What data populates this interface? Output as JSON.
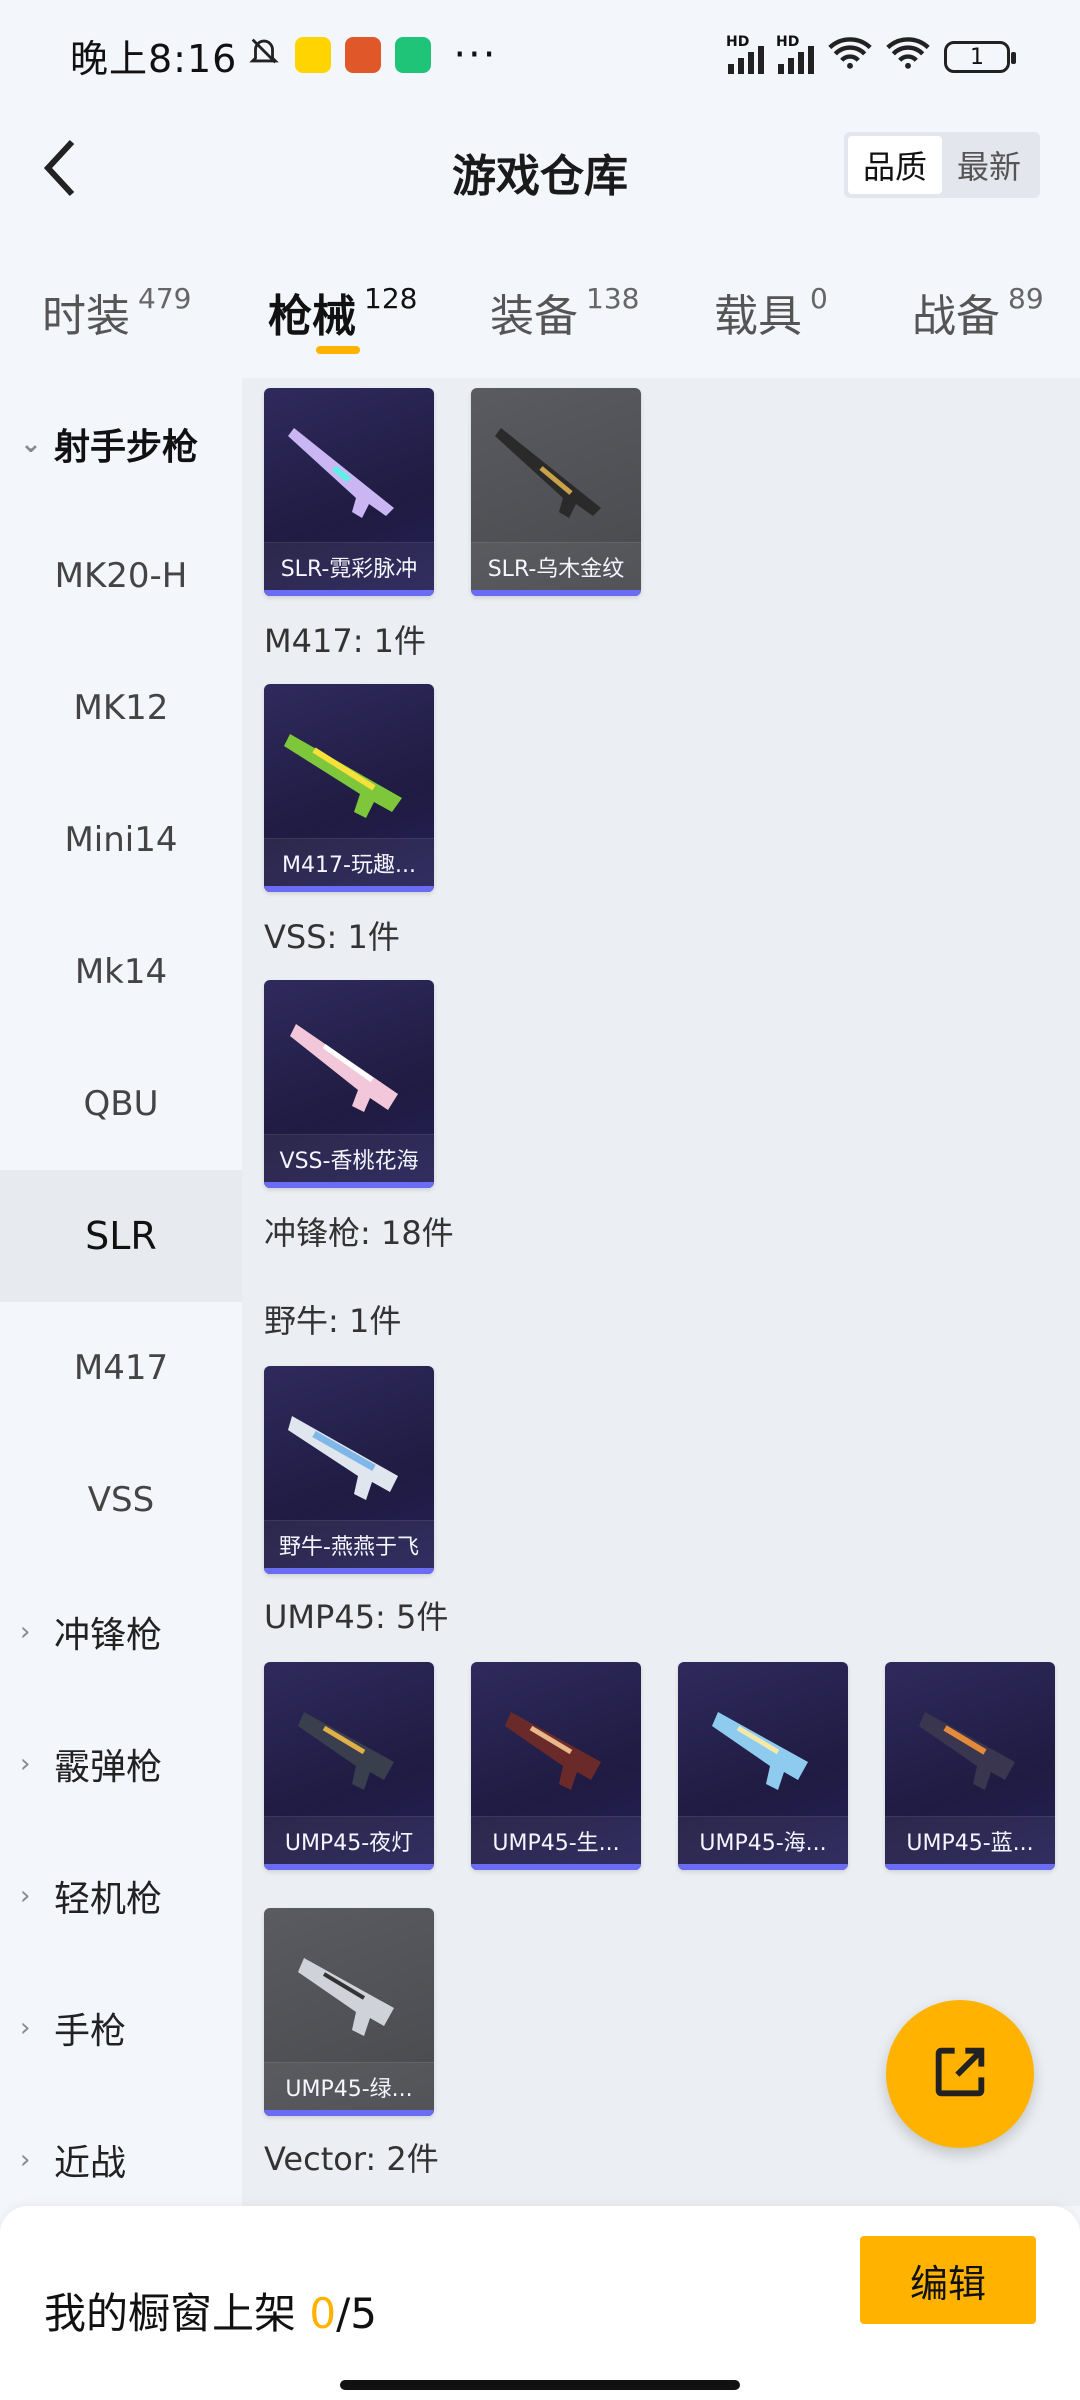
{
  "status": {
    "time": "晚上8:16",
    "battery": "1",
    "hd1": "HD",
    "hd2": "HD"
  },
  "header": {
    "title": "游戏仓库",
    "sort_quality": "品质",
    "sort_newest": "最新"
  },
  "tabs": [
    {
      "label": "时装",
      "count": "479"
    },
    {
      "label": "枪械",
      "count": "128"
    },
    {
      "label": "装备",
      "count": "138"
    },
    {
      "label": "载具",
      "count": "0"
    },
    {
      "label": "战备",
      "count": "89"
    }
  ],
  "sidebar": {
    "group": "射手步枪",
    "items": [
      "MK20-H",
      "MK12",
      "Mini14",
      "Mk14",
      "QBU",
      "SLR",
      "M417",
      "VSS"
    ],
    "selected": "SLR",
    "categories": [
      "冲锋枪",
      "霰弹枪",
      "轻机枪",
      "手枪",
      "近战"
    ]
  },
  "content": {
    "slr_cards": [
      "SLR-霓彩脉冲",
      "SLR-乌木金纹"
    ],
    "m417_header": "M417: 1件",
    "m417_cards": [
      "M417-玩趣..."
    ],
    "vss_header": "VSS: 1件",
    "vss_cards": [
      "VSS-香桃花海"
    ],
    "smg_header": "冲锋枪: 18件",
    "bison_header": "野牛: 1件",
    "bison_cards": [
      "野牛-燕燕于飞"
    ],
    "ump_header": "UMP45: 5件",
    "ump_cards": [
      "UMP45-夜灯",
      "UMP45-生...",
      "UMP45-海...",
      "UMP45-蓝...",
      "UMP45-绿..."
    ],
    "vector_header": "Vector: 2件"
  },
  "bottom": {
    "label": "我的橱窗上架",
    "current": "0",
    "total": "/5",
    "edit": "编辑"
  },
  "colors": {
    "accent": "#ffb300",
    "card_purple": "#2f2a5c",
    "card_gray": "#55565b",
    "card_edge": "#6b6cf4"
  }
}
